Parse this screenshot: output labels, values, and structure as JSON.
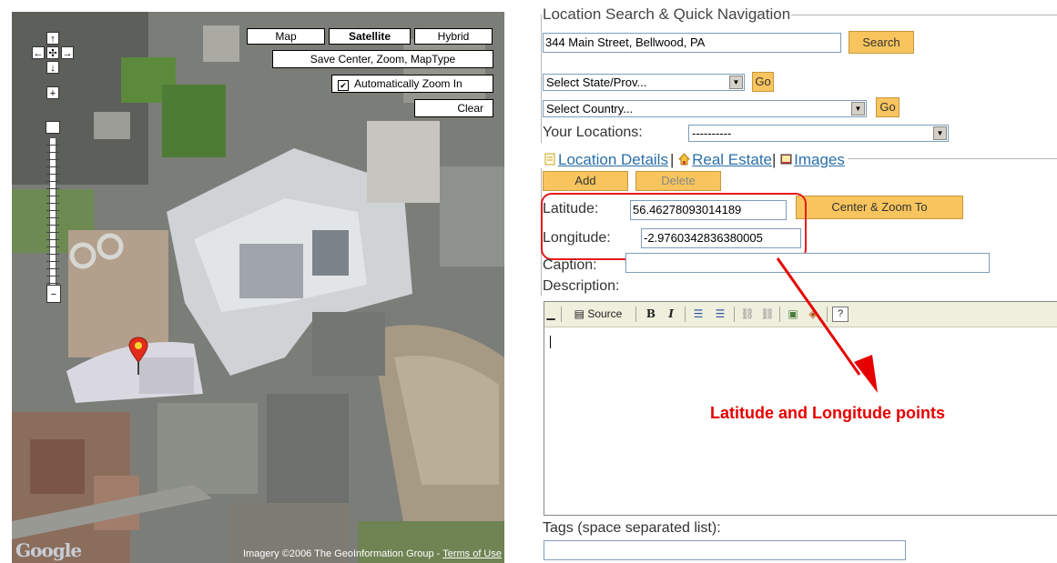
{
  "map": {
    "map_types": [
      "Map",
      "Satellite",
      "Hybrid"
    ],
    "selected_type": "Satellite",
    "save_button": "Save Center, Zoom, MapType",
    "auto_zoom_label": "Automatically Zoom In",
    "auto_zoom_checked": true,
    "clear_button": "Clear",
    "nav": {
      "up": "↑",
      "down": "↓",
      "left": "←",
      "right": "→",
      "center": "✣",
      "zoom_in": "+",
      "zoom_out": "−"
    },
    "attribution_prefix": "Imagery ©2006 The GeoInformation Group - ",
    "attribution_link": "Terms of Use",
    "logo": "Google"
  },
  "search": {
    "legend": "Location Search & Quick Navigation",
    "address_value": "344 Main Street, Bellwood, PA",
    "search_button": "Search",
    "state_select": "Select State/Prov...",
    "country_select": "Select Country...",
    "go_label": "Go",
    "your_locations_label": "Your Locations:",
    "your_locations_value": "----------"
  },
  "details": {
    "tabs": [
      "Location Details",
      "Real Estate",
      "Images"
    ],
    "add_button": "Add",
    "delete_button": "Delete",
    "latitude_label": "Latitude:",
    "latitude_value": "56.46278093014189",
    "longitude_label": "Longitude:",
    "longitude_value": "-2.9760342836380005",
    "center_zoom_button": "Center & Zoom To",
    "caption_label": "Caption:",
    "description_label": "Description:",
    "source_button": "Source",
    "tags_label": "Tags (space separated list):"
  },
  "annotation": {
    "text": "Latitude and Longitude points",
    "color": "#e60000"
  }
}
